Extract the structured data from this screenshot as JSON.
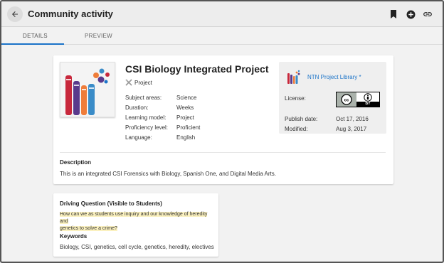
{
  "header": {
    "title": "Community activity",
    "icons": [
      "back-arrow-icon",
      "bookmark-icon",
      "add-circle-icon",
      "link-icon"
    ]
  },
  "tabs": [
    {
      "label": "DETAILS",
      "active": true
    },
    {
      "label": "PREVIEW",
      "active": false
    }
  ],
  "resource": {
    "title": "CSI Biology Integrated Project",
    "type": "Project",
    "meta": [
      {
        "key": "Subject areas:",
        "value": "Science"
      },
      {
        "key": "Duration:",
        "value": "Weeks"
      },
      {
        "key": "Learning model:",
        "value": "Project"
      },
      {
        "key": "Proficiency level:",
        "value": "Proficient"
      },
      {
        "key": "Language:",
        "value": "English"
      }
    ],
    "library": {
      "name": "NTN Project Library *",
      "license_label": "License:",
      "license_badge": "BY",
      "publish_label": "Publish date:",
      "publish_value": "Oct 17, 2016",
      "modified_label": "Modified:",
      "modified_value": "Aug 3, 2017"
    },
    "description_heading": "Description",
    "description": "This is an integrated CSI Forensics with Biology, Spanish One, and Digital Media Arts."
  },
  "driving_question": {
    "heading": "Driving Question (Visible to Students)",
    "line1": "How can we as students use inquiry and our knowledge of heredity and",
    "line2": "genetics to solve a crime?"
  },
  "keywords": {
    "heading": "Keywords",
    "text": "Biology, CSI, genetics, cell cycle, genetics, heredity, electives"
  },
  "colors": {
    "accent": "#1a73c8",
    "highlight": "#fbf1bf",
    "book_red": "#c8283c",
    "book_purple": "#5a3a8c",
    "book_orange": "#ef7d3a",
    "book_blue": "#3a8cc8"
  }
}
